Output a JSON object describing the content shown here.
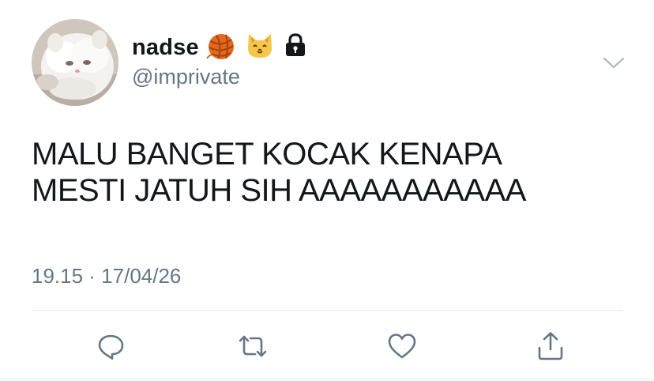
{
  "author": {
    "display_name": "nadse",
    "name_emojis": [
      "yarn-icon",
      "cat-face-icon",
      "lock-icon"
    ],
    "handle": "@imprivate",
    "avatar": "white-persian-cat-photo"
  },
  "tweet": {
    "text": "MALU BANGET KOCAK KENAPA\nMESTI JATUH SIH AAAAAAAAAAA",
    "timestamp": "19.15 · 17/04/26"
  },
  "actions": [
    {
      "name": "reply",
      "icon": "comment-icon"
    },
    {
      "name": "retweet",
      "icon": "retweet-icon"
    },
    {
      "name": "like",
      "icon": "heart-icon"
    },
    {
      "name": "share",
      "icon": "share-icon"
    }
  ],
  "colors": {
    "text": "#14171a",
    "secondary": "#657786",
    "divider": "#e1e8ed",
    "icon": "#657786"
  }
}
